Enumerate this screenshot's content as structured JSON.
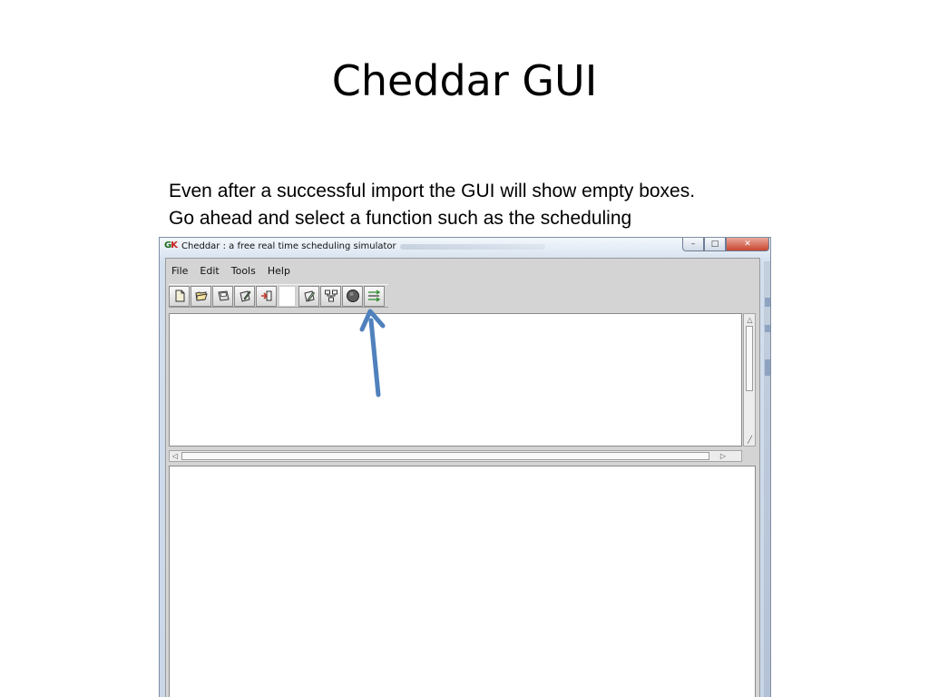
{
  "slide": {
    "title": "Cheddar GUI",
    "caption_line1": "Even after a successful import the GUI will show empty boxes.",
    "caption_line2": "Go ahead and select a function such as the scheduling"
  },
  "window": {
    "logo_green": "G",
    "logo_red": "K",
    "title": "Cheddar : a free real time scheduling simulator",
    "buttons": {
      "minimize": "–",
      "maximize": "□",
      "close": "✕"
    }
  },
  "menu": [
    "File",
    "Edit",
    "Tools",
    "Help"
  ],
  "toolbar": {
    "icons": [
      "new-file-icon",
      "open-folder-icon",
      "save-disk-icon",
      "edit-icon",
      "exit-icon",
      "edit-tool-icon",
      "network-icon",
      "record-icon",
      "scheduling-icon"
    ]
  },
  "colors": {
    "annotation_arrow": "#4f81bd",
    "window_frame": "#c8d6e8",
    "client_bg": "#d4d4d4"
  }
}
